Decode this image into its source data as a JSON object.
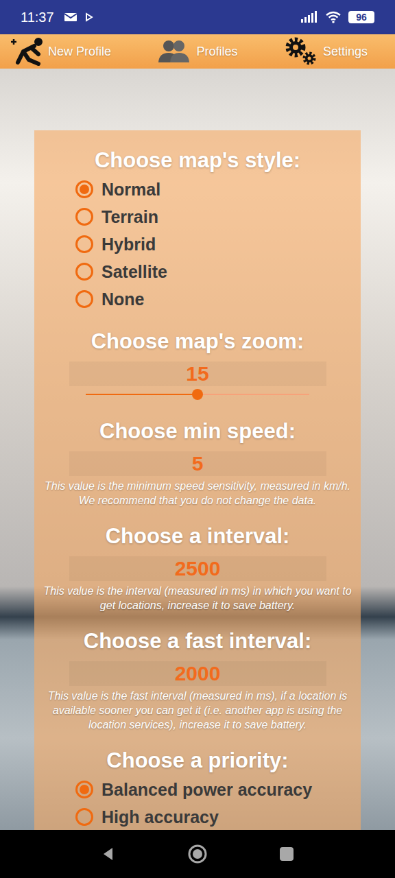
{
  "status_bar": {
    "time": "11:37",
    "battery": "96"
  },
  "toolbar": [
    {
      "label": "New Profile"
    },
    {
      "label": "Profiles"
    },
    {
      "label": "Settings"
    }
  ],
  "settings": [
    {
      "kind": "radio",
      "title": "Choose map's style:",
      "options": [
        {
          "label": "Normal",
          "selected": true
        },
        {
          "label": "Terrain",
          "selected": false
        },
        {
          "label": "Hybrid",
          "selected": false
        },
        {
          "label": "Satellite",
          "selected": false
        },
        {
          "label": "None",
          "selected": false
        }
      ]
    },
    {
      "kind": "slider",
      "title": "Choose map's zoom:",
      "value": "15",
      "level": 0.5
    },
    {
      "kind": "number",
      "title": "Choose min speed:",
      "value": "5",
      "hint": "This value is the minimum speed sensitivity, measured in km/h. We recommend that you do not change the data."
    },
    {
      "kind": "number",
      "title": "Choose a interval:",
      "value": "2500",
      "hint": "This value is the interval (measured in ms) in which you want to get locations, increase it to save battery."
    },
    {
      "kind": "number",
      "title": "Choose a fast interval:",
      "value": "2000",
      "hint": "This value is the fast interval (measured in ms), if a location is available sooner you can get it (i.e. another app is using the location services), increase it to save battery."
    },
    {
      "kind": "radio",
      "title": "Choose a priority:",
      "options": [
        {
          "label": "Balanced power accuracy",
          "selected": true
        },
        {
          "label": "High accuracy",
          "selected": false
        }
      ]
    }
  ]
}
